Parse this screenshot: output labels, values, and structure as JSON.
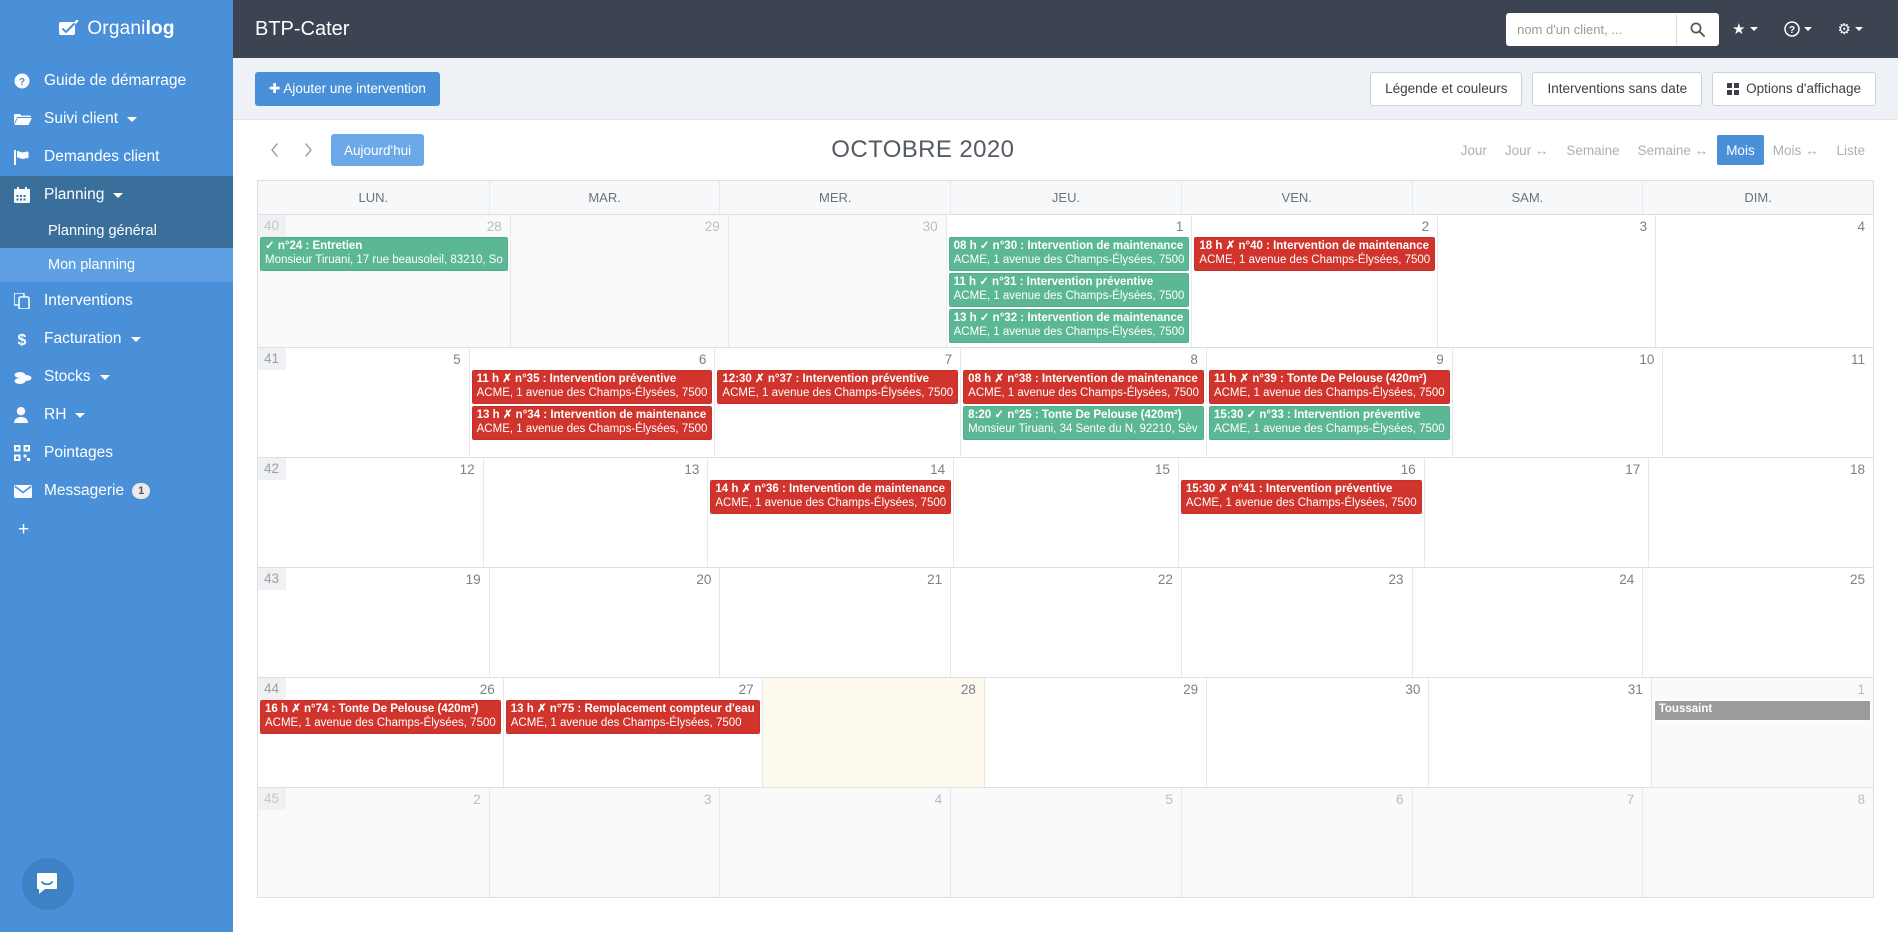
{
  "brand": {
    "name_light": "Organi",
    "name_bold": "log",
    "logo_icon": "check-clipboard-icon"
  },
  "sidebar": {
    "items": [
      {
        "label": "Guide de démarrage",
        "icon": "question-circle-icon",
        "caret": false
      },
      {
        "label": "Suivi client",
        "icon": "folder-open-icon",
        "caret": true
      },
      {
        "label": "Demandes client",
        "icon": "flag-icon",
        "caret": false
      },
      {
        "label": "Planning",
        "icon": "calendar-icon",
        "caret": true
      },
      {
        "label": "Interventions",
        "icon": "copy-icon",
        "caret": false
      },
      {
        "label": "Facturation",
        "icon": "dollar-icon",
        "caret": true
      },
      {
        "label": "Stocks",
        "icon": "coins-icon",
        "caret": true
      },
      {
        "label": "RH",
        "icon": "user-icon",
        "caret": true
      },
      {
        "label": "Pointages",
        "icon": "qrcode-icon",
        "caret": false
      },
      {
        "label": "Messagerie",
        "icon": "envelope-icon",
        "caret": false,
        "badge": "1"
      }
    ],
    "planning_sub": [
      {
        "label": "Planning général",
        "active": false
      },
      {
        "label": "Mon planning",
        "active": true
      }
    ],
    "add_label": "+",
    "chat_icon": "chat-bubble-icon"
  },
  "topbar": {
    "app_title": "BTP-Cater",
    "search_placeholder": "nom d'un client, ...",
    "search_value": "",
    "search_icon": "search-icon",
    "icons": [
      {
        "name": "star-icon",
        "glyph": "★"
      },
      {
        "name": "help-icon",
        "glyph": "?"
      },
      {
        "name": "gear-icon",
        "glyph": "⚙"
      }
    ]
  },
  "actionbar": {
    "add_intervention": "Ajouter une intervention",
    "legend": "Légende et couleurs",
    "no_date": "Interventions sans date",
    "display_options": "Options d'affichage"
  },
  "calbar": {
    "prev_icon": "chevron-left-icon",
    "next_icon": "chevron-right-icon",
    "today": "Aujourd'hui",
    "title": "OCTOBRE 2020",
    "views": [
      {
        "label": "Jour",
        "active": false
      },
      {
        "label": "Jour ↔",
        "active": false
      },
      {
        "label": "Semaine",
        "active": false
      },
      {
        "label": "Semaine ↔",
        "active": false
      },
      {
        "label": "Mois",
        "active": true
      },
      {
        "label": "Mois ↔",
        "active": false
      },
      {
        "label": "Liste",
        "active": false
      }
    ]
  },
  "calendar": {
    "dow": [
      "LUN.",
      "MAR.",
      "MER.",
      "JEU.",
      "VEN.",
      "SAM.",
      "DIM."
    ],
    "weeks": [
      {
        "num": "40",
        "days": [
          {
            "n": "28",
            "other": true,
            "events": [
              {
                "color": "green",
                "l1": "✓ n°24 : Entretien",
                "l2": "Monsieur Tiruani, 17 rue beausoleil, 83210, So"
              }
            ]
          },
          {
            "n": "29",
            "other": true,
            "events": []
          },
          {
            "n": "30",
            "other": true,
            "events": []
          },
          {
            "n": "1",
            "other": false,
            "events": [
              {
                "color": "green",
                "l1": "08 h ✓ n°30 : Intervention de maintenance",
                "l2": "ACME, 1 avenue des Champs-Élysées, 7500"
              },
              {
                "color": "green",
                "l1": "11 h ✓ n°31 : Intervention préventive",
                "l2": "ACME, 1 avenue des Champs-Élysées, 7500"
              },
              {
                "color": "green",
                "l1": "13 h ✓ n°32 : Intervention de maintenance",
                "l2": "ACME, 1 avenue des Champs-Élysées, 7500"
              }
            ]
          },
          {
            "n": "2",
            "other": false,
            "events": [
              {
                "color": "red",
                "l1": "18 h ✗ n°40 : Intervention de maintenance",
                "l2": "ACME, 1 avenue des Champs-Élysées, 7500"
              }
            ]
          },
          {
            "n": "3",
            "other": false,
            "events": []
          },
          {
            "n": "4",
            "other": false,
            "events": []
          }
        ]
      },
      {
        "num": "41",
        "days": [
          {
            "n": "5",
            "other": false,
            "events": []
          },
          {
            "n": "6",
            "other": false,
            "events": [
              {
                "color": "red",
                "l1": "11 h ✗ n°35 : Intervention préventive",
                "l2": "ACME, 1 avenue des Champs-Élysées, 7500"
              },
              {
                "color": "red",
                "l1": "13 h ✗ n°34 : Intervention de maintenance",
                "l2": "ACME, 1 avenue des Champs-Élysées, 7500"
              }
            ]
          },
          {
            "n": "7",
            "other": false,
            "events": [
              {
                "color": "red",
                "l1": "12:30 ✗ n°37 : Intervention préventive",
                "l2": "ACME, 1 avenue des Champs-Élysées, 7500"
              }
            ]
          },
          {
            "n": "8",
            "other": false,
            "events": [
              {
                "color": "red",
                "l1": "08 h ✗ n°38 : Intervention de maintenance",
                "l2": "ACME, 1 avenue des Champs-Élysées, 7500"
              },
              {
                "color": "green",
                "l1": "8:20 ✓ n°25 : Tonte De Pelouse (420m²)",
                "l2": "Monsieur Tiruani, 34 Sente du N, 92210, Sèv"
              }
            ]
          },
          {
            "n": "9",
            "other": false,
            "events": [
              {
                "color": "red",
                "l1": "11 h ✗ n°39 : Tonte De Pelouse (420m²)",
                "l2": "ACME, 1 avenue des Champs-Élysées, 7500"
              },
              {
                "color": "green",
                "l1": "15:30 ✓ n°33 : Intervention préventive",
                "l2": "ACME, 1 avenue des Champs-Élysées, 7500"
              }
            ]
          },
          {
            "n": "10",
            "other": false,
            "events": []
          },
          {
            "n": "11",
            "other": false,
            "events": []
          }
        ]
      },
      {
        "num": "42",
        "days": [
          {
            "n": "12",
            "other": false,
            "events": []
          },
          {
            "n": "13",
            "other": false,
            "events": []
          },
          {
            "n": "14",
            "other": false,
            "events": [
              {
                "color": "red",
                "l1": "14 h ✗ n°36 : Intervention de maintenance",
                "l2": "ACME, 1 avenue des Champs-Élysées, 7500"
              }
            ]
          },
          {
            "n": "15",
            "other": false,
            "events": []
          },
          {
            "n": "16",
            "other": false,
            "events": [
              {
                "color": "red",
                "l1": "15:30 ✗ n°41 : Intervention préventive",
                "l2": "ACME, 1 avenue des Champs-Élysées, 7500"
              }
            ]
          },
          {
            "n": "17",
            "other": false,
            "events": []
          },
          {
            "n": "18",
            "other": false,
            "events": []
          }
        ]
      },
      {
        "num": "43",
        "days": [
          {
            "n": "19",
            "other": false,
            "events": []
          },
          {
            "n": "20",
            "other": false,
            "events": []
          },
          {
            "n": "21",
            "other": false,
            "events": []
          },
          {
            "n": "22",
            "other": false,
            "events": []
          },
          {
            "n": "23",
            "other": false,
            "events": []
          },
          {
            "n": "24",
            "other": false,
            "events": []
          },
          {
            "n": "25",
            "other": false,
            "events": []
          }
        ]
      },
      {
        "num": "44",
        "days": [
          {
            "n": "26",
            "other": false,
            "events": [
              {
                "color": "red",
                "l1": "16 h ✗ n°74 : Tonte De Pelouse (420m²)",
                "l2": "ACME, 1 avenue des Champs-Élysées, 7500"
              }
            ]
          },
          {
            "n": "27",
            "other": false,
            "events": [
              {
                "color": "red",
                "l1": "13 h ✗ n°75 : Remplacement compteur d'eau",
                "l2": "ACME, 1 avenue des Champs-Élysées, 7500"
              }
            ]
          },
          {
            "n": "28",
            "other": false,
            "today": true,
            "events": []
          },
          {
            "n": "29",
            "other": false,
            "events": []
          },
          {
            "n": "30",
            "other": false,
            "events": []
          },
          {
            "n": "31",
            "other": false,
            "events": []
          },
          {
            "n": "1",
            "other": true,
            "events": [
              {
                "color": "gray",
                "l1": "Toussaint",
                "l2": ""
              }
            ]
          }
        ]
      },
      {
        "num": "45",
        "days": [
          {
            "n": "2",
            "other": true,
            "events": []
          },
          {
            "n": "3",
            "other": true,
            "events": []
          },
          {
            "n": "4",
            "other": true,
            "events": []
          },
          {
            "n": "5",
            "other": true,
            "events": []
          },
          {
            "n": "6",
            "other": true,
            "events": []
          },
          {
            "n": "7",
            "other": true,
            "events": []
          },
          {
            "n": "8",
            "other": true,
            "events": []
          }
        ]
      }
    ]
  },
  "colors": {
    "sidebar_blue": "#4a90d9",
    "topbar_dark": "#3c4452",
    "event_green": "#5cb894",
    "event_red": "#d0342c",
    "event_gray": "#9b9b9b",
    "today_bg": "#fdf9ed"
  }
}
